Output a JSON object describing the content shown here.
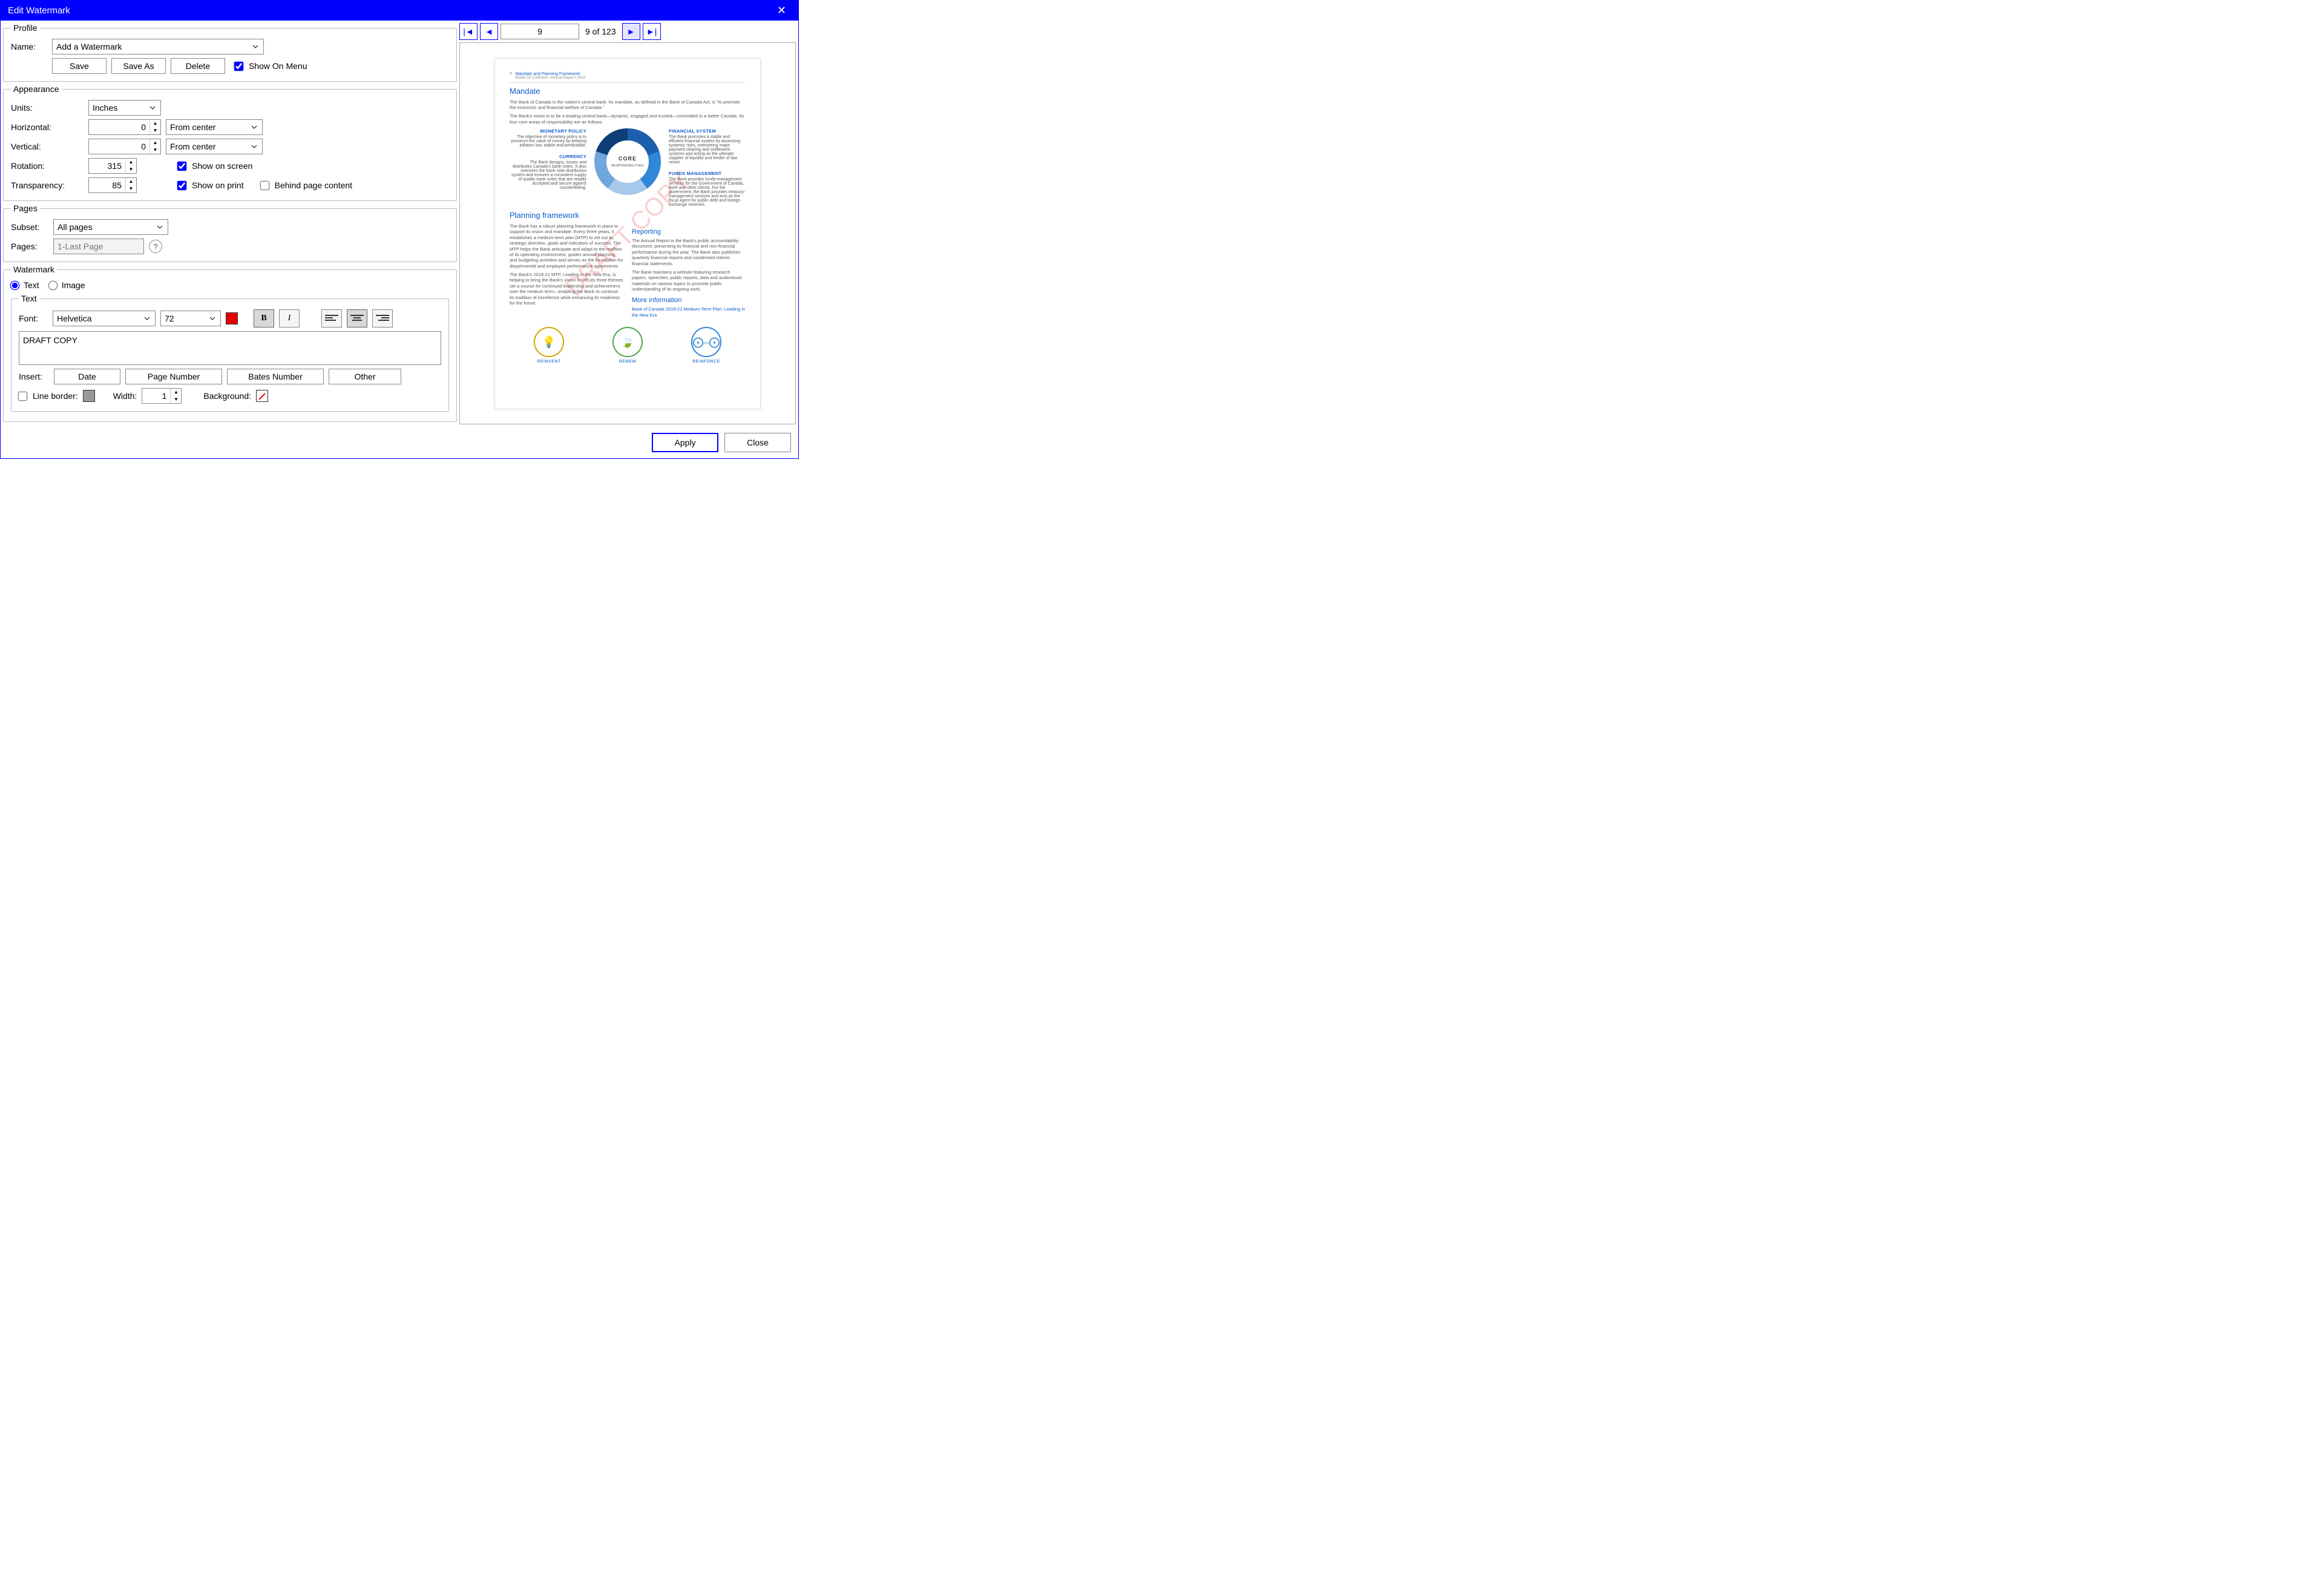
{
  "title": "Edit Watermark",
  "profile": {
    "legend": "Profile",
    "name_label": "Name:",
    "name_value": "Add a Watermark",
    "save": "Save",
    "save_as": "Save As",
    "delete": "Delete",
    "show_on_menu": "Show On Menu",
    "show_on_menu_checked": true
  },
  "appearance": {
    "legend": "Appearance",
    "units_label": "Units:",
    "units_value": "Inches",
    "horizontal_label": "Horizontal:",
    "horizontal_value": "0",
    "horizontal_anchor": "From center",
    "vertical_label": "Vertical:",
    "vertical_value": "0",
    "vertical_anchor": "From center",
    "rotation_label": "Rotation:",
    "rotation_value": "315",
    "transparency_label": "Transparency:",
    "transparency_value": "85",
    "show_on_screen": "Show on screen",
    "show_on_screen_checked": true,
    "show_on_print": "Show on print",
    "show_on_print_checked": true,
    "behind_page_content": "Behind page content",
    "behind_page_content_checked": false
  },
  "pages": {
    "legend": "Pages",
    "subset_label": "Subset:",
    "subset_value": "All pages",
    "pages_label": "Pages:",
    "pages_placeholder": "1-Last Page"
  },
  "watermark": {
    "legend": "Watermark",
    "mode_text": "Text",
    "mode_image": "Image",
    "mode_selected": "text",
    "text_legend": "Text",
    "font_label": "Font:",
    "font_value": "Helvetica",
    "size_value": "72",
    "color_hex": "#e40000",
    "bold_active": true,
    "italic_active": false,
    "align": "center",
    "content": "DRAFT COPY",
    "insert_label": "Insert:",
    "insert_date": "Date",
    "insert_page_number": "Page Number",
    "insert_bates": "Bates Number",
    "insert_other": "Other",
    "line_border_label": "Line border:",
    "line_border_checked": false,
    "width_label": "Width:",
    "width_value": "1",
    "background_label": "Background:"
  },
  "pager": {
    "current": "9",
    "info": "9 of 123"
  },
  "preview": {
    "header_line1": "Mandate and Planning Framework",
    "header_line2": "BANK OF CANADA • Annual Report • 2018",
    "mandate_h": "Mandate",
    "mandate_p1": "The Bank of Canada is the nation's central bank. Its mandate, as defined in the Bank of Canada Act, is \"to promote the economic and financial welfare of Canada.\"",
    "mandate_p2": "The Bank's vision is to be a leading central bank—dynamic, engaged and trusted—committed to a better Canada. Its four core areas of responsibility are as follows:",
    "core_label": "CORE",
    "core_sub": "RESPONSIBILITIES",
    "mp_h": "MONETARY POLICY",
    "mp_t": "The objective of monetary policy is to preserve the value of money by keeping inflation low, stable and predictable.",
    "fs_h": "FINANCIAL SYSTEM",
    "fs_t": "The Bank promotes a stable and efficient financial system by assessing systemic risks, overseeing major payment clearing and settlement systems and acting as the ultimate supplier of liquidity and lender of last resort.",
    "cu_h": "CURRENCY",
    "cu_t": "The Bank designs, issues and distributes Canada's bank notes. It also oversees the bank note distribution system and ensures a consistent supply of quality bank notes that are readily accepted and secure against counterfeiting.",
    "fm_h": "FUNDS MANAGEMENT",
    "fm_t": "The Bank provides funds-management services for the Government of Canada, itself and other clients. For the government, the Bank provides treasury-management services and acts as the fiscal agent for public debt and foreign exchange reserves.",
    "plan_h": "Planning framework",
    "plan_p1": "The Bank has a robust planning framework in place to support its vision and mandate. Every three years, it establishes a medium-term plan (MTP) to set out its strategic direction, goals and indicators of success. The MTP helps the Bank anticipate and adapt to the realities of its operating environment, guides annual planning and budgeting activities and serves as the foundation for departmental and employee performance agreements.",
    "plan_p2": "The Bank's 2019-21 MTP, Leading in the New Era, is helping to bring the Bank's vision to life. Its three themes set a course for continued leadership and achievement over the medium term—enabling the Bank to continue its tradition of excellence while enhancing its readiness for the future.",
    "rep_h": "Reporting",
    "rep_p1": "The Annual Report is the Bank's public accountability document, presenting its financial and non-financial performance during the year. The Bank also publishes quarterly financial reports and condensed interim financial statements.",
    "rep_p2": "The Bank maintains a website featuring research papers, speeches, public reports, data and audiovisual materials on various topics to promote public understanding of its ongoing work.",
    "more_h": "More information",
    "more_link": "Bank of Canada  2019-21 Medium-Term Plan: Leading in the New Era",
    "ic1": "REINVENT",
    "ic2": "RENEW",
    "ic3": "REINFORCE"
  },
  "footer": {
    "apply": "Apply",
    "close": "Close"
  }
}
